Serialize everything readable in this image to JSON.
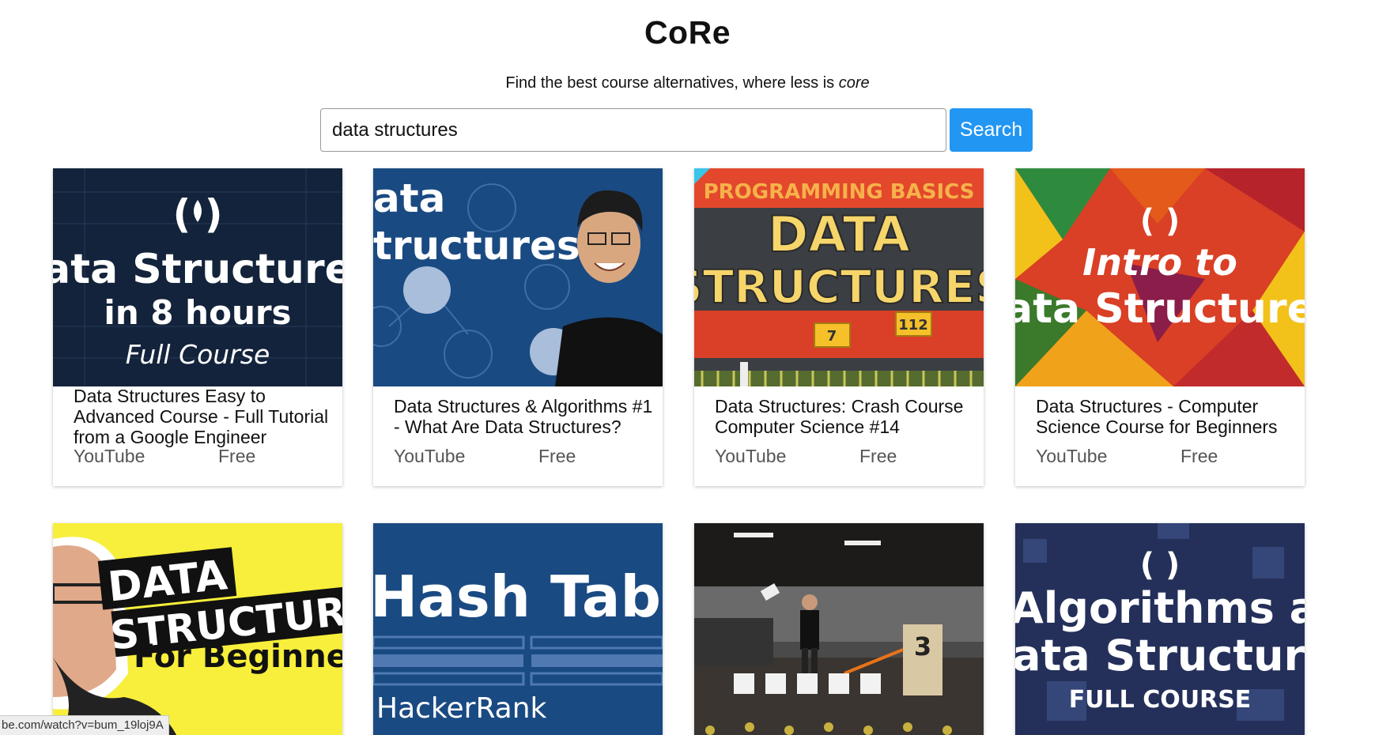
{
  "header": {
    "title": "CoRe",
    "tagline_prefix": "Find the best course alternatives, where less is ",
    "tagline_emphasis": "core"
  },
  "search": {
    "value": "data structures",
    "button_label": "Search"
  },
  "results": [
    {
      "title": "Data Structures Easy to Advanced Course - Full Tutorial from a Google Engineer",
      "source": "YouTube",
      "price": "Free",
      "thumbnail_text": [
        "( )",
        "ata Structure",
        "in 8 hours",
        "Full Course"
      ]
    },
    {
      "title": "Data Structures & Algorithms #1 - What Are Data Structures?",
      "source": "YouTube",
      "price": "Free",
      "thumbnail_text": [
        "ata",
        "tructures"
      ]
    },
    {
      "title": "Data Structures: Crash Course Computer Science #14",
      "source": "YouTube",
      "price": "Free",
      "thumbnail_text": [
        "PROGRAMMING BASICS",
        "DATA",
        "STRUCTURES",
        "7",
        "112"
      ]
    },
    {
      "title": "Data Structures - Computer Science Course for Beginners",
      "source": "YouTube",
      "price": "Free",
      "thumbnail_text": [
        "( )",
        "Intro to",
        "ata Structure"
      ]
    },
    {
      "thumbnail_text": [
        "DATA",
        "STRUCTURI",
        "For Beginne"
      ]
    },
    {
      "thumbnail_text": [
        "Hash Table",
        "HackerRank"
      ]
    },
    {
      "thumbnail_text": [
        "3"
      ]
    },
    {
      "thumbnail_text": [
        "( )",
        "Algorithms and",
        "ata Structure",
        "FULL COURSE"
      ]
    }
  ],
  "status_bar": {
    "url_fragment": "be.com/watch?v=bum_19loj9A"
  },
  "colors": {
    "accent": "#2196f3"
  }
}
